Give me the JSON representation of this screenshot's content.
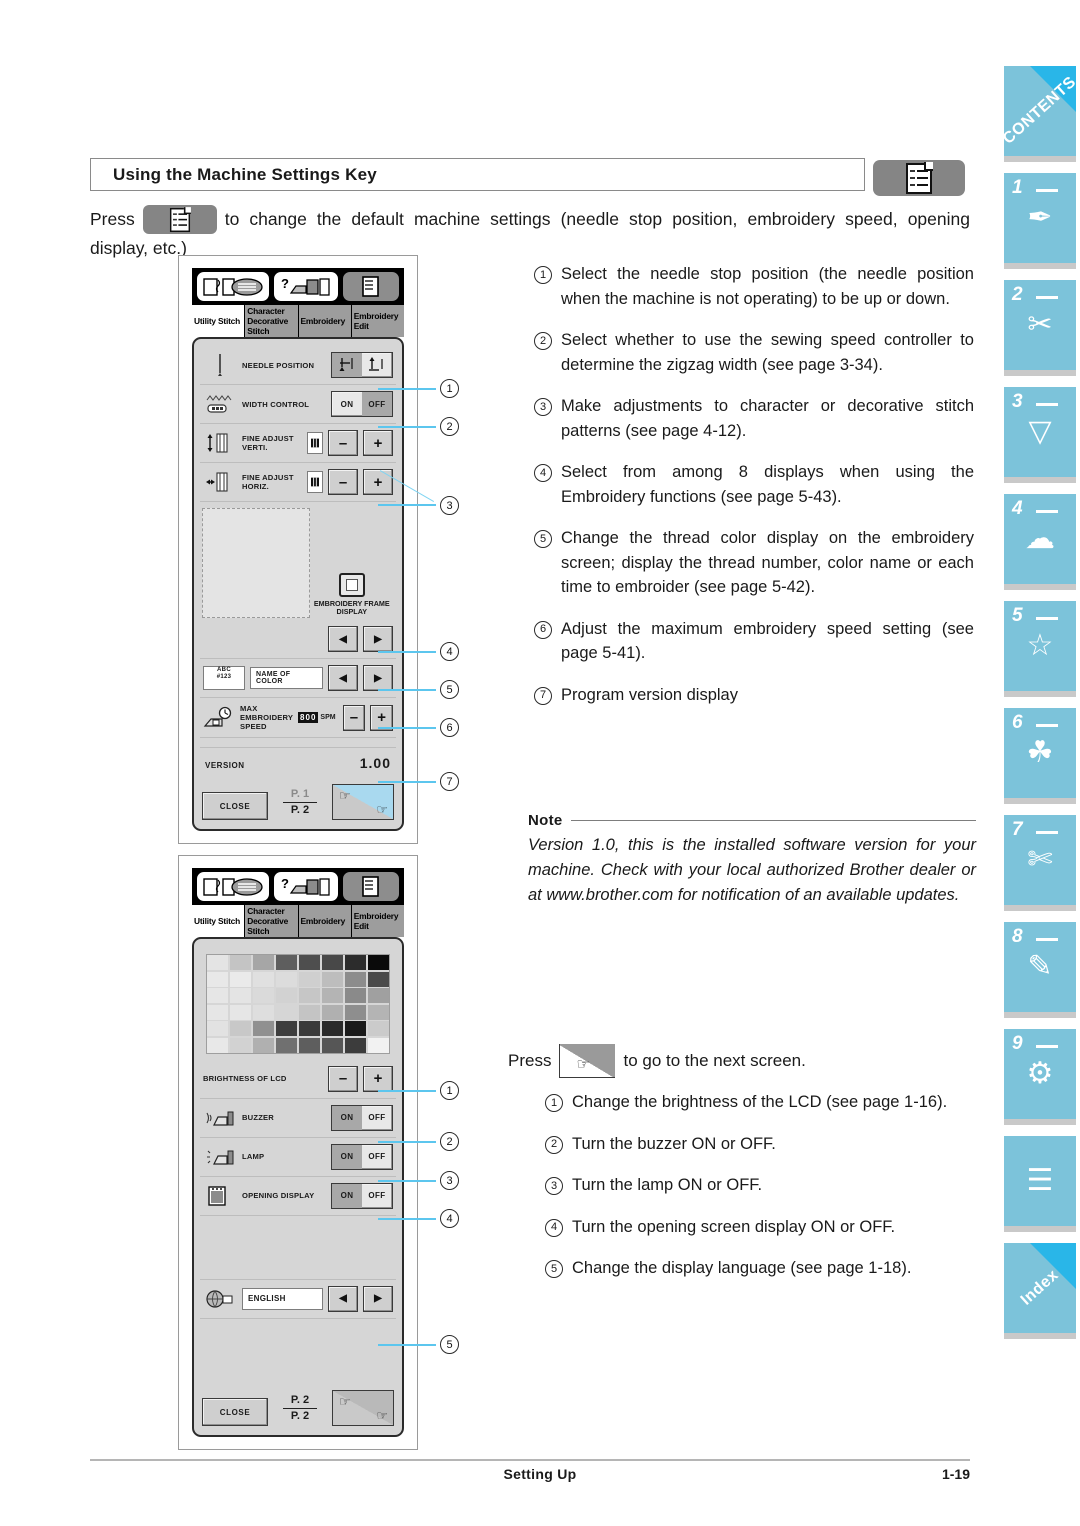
{
  "header": {
    "section_title": "Using the Machine Settings Key",
    "settings_key_icon": "checklist-document-icon"
  },
  "intro": {
    "press_label": "Press",
    "text_after_key": "to change the default machine settings (needle stop position, embroidery speed, opening display, etc.)"
  },
  "screen1": {
    "nav_icons": [
      "sewing-machine-stitch-icon",
      "help-machine-icon",
      "settings-checklist-icon"
    ],
    "tabs": [
      {
        "label": "Utility Stitch",
        "active": true
      },
      {
        "label": "Character Decorative Stitch",
        "active": false
      },
      {
        "label": "Embroidery",
        "active": false
      },
      {
        "label": "Embroidery Edit",
        "active": false
      }
    ],
    "rows": [
      {
        "label": "NEEDLE POSITION",
        "icon": "needle-icon",
        "control": "needle-updown-toggle",
        "options": [
          "down",
          "up"
        ],
        "selected": "down"
      },
      {
        "label": "WIDTH CONTROL",
        "icon": "zigzag-width-icon",
        "control": "on-off-toggle",
        "options": [
          "ON",
          "OFF"
        ],
        "selected": "OFF"
      },
      {
        "label": "FINE ADJUST VERTI.",
        "icon": "vertical-arrow-icon",
        "control": "minus-plus",
        "minus": "–",
        "plus": "+"
      },
      {
        "label": "FINE ADJUST HORIZ.",
        "icon": "horizontal-arrow-icon",
        "control": "minus-plus",
        "minus": "–",
        "plus": "+"
      }
    ],
    "frame_display": {
      "caption": "EMBROIDERY FRAME DISPLAY",
      "icon": "embroidery-hoop-icon",
      "left": "◀",
      "right": "▶"
    },
    "color_row": {
      "icon": "thread-abc-123-icon",
      "icon_text_1": "ABC",
      "icon_text_2": "#123",
      "value": "NAME OF COLOR",
      "left": "◀",
      "right": "▶"
    },
    "speed_row": {
      "icon": "max-speed-icon",
      "label": "MAX EMBROIDERY SPEED",
      "value": "800",
      "unit": "SPM",
      "minus": "–",
      "plus": "+"
    },
    "version": {
      "label": "VERSION",
      "value": "1.00"
    },
    "close_label": "CLOSE",
    "pager": {
      "current": "P. 1",
      "total": "P. 2"
    },
    "next_key_icon": "pointing-hand-next-icon"
  },
  "screen2": {
    "tabs": [
      {
        "label": "Utility Stitch",
        "active": true
      },
      {
        "label": "Character Decorative Stitch",
        "active": false
      },
      {
        "label": "Embroidery",
        "active": false
      },
      {
        "label": "Embroidery Edit",
        "active": false
      }
    ],
    "grayscale_grid": {
      "columns": 8,
      "rows": [
        [
          "#e4e4e4",
          "#c4c4c4",
          "#a6a6a6",
          "#5e5e5e",
          "#4e4e4e",
          "#484848",
          "#2c2c2c",
          "#0a0a0a"
        ],
        [
          "#e8e8e8",
          "#eaeaea",
          "#e0e0e0",
          "#dcdcdc",
          "#cfcfcf",
          "#bdbdbd",
          "#8c8c8c",
          "#4a4a4a"
        ],
        [
          "#e6e6e6",
          "#e4e4e4",
          "#dadada",
          "#d2d2d2",
          "#c6c6c6",
          "#b4b4b4",
          "#8a8a8a",
          "#a0a0a0"
        ],
        [
          "#e6e6e6",
          "#e6e6e6",
          "#dedede",
          "#d6d6d6",
          "#c4c4c4",
          "#b0b0b0",
          "#8e8e8e",
          "#b4b4b4"
        ],
        [
          "#e2e2e2",
          "#c8c8c8",
          "#909090",
          "#3d3d3d",
          "#3a3a3a",
          "#2a2a2a",
          "#1a1a1a",
          "#cbcbcb"
        ],
        [
          "#e8e8e8",
          "#d2d2d2",
          "#b0b0b0",
          "#707070",
          "#5e5e5e",
          "#565656",
          "#3c3c3c",
          "#f2f2f2"
        ]
      ]
    },
    "brightness_row": {
      "label": "BRIGHTNESS OF LCD",
      "minus": "–",
      "plus": "+"
    },
    "rows": [
      {
        "label": "BUZZER",
        "icon": "buzzer-machine-icon",
        "options": [
          "ON",
          "OFF"
        ],
        "selected": "ON"
      },
      {
        "label": "LAMP",
        "icon": "lamp-machine-icon",
        "options": [
          "ON",
          "OFF"
        ],
        "selected": "ON"
      },
      {
        "label": "OPENING DISPLAY",
        "icon": "opening-display-icon",
        "options": [
          "ON",
          "OFF"
        ],
        "selected": "ON"
      }
    ],
    "language_row": {
      "icon": "globe-language-icon",
      "value": "ENGLISH",
      "left": "◀",
      "right": "▶"
    },
    "close_label": "CLOSE",
    "pager": {
      "current": "P. 2",
      "total": "P. 2"
    },
    "next_key_icon": "pointing-hand-next-icon"
  },
  "callouts_screen1": [
    "1",
    "2",
    "3",
    "4",
    "5",
    "6",
    "7"
  ],
  "callouts_screen2": [
    "1",
    "2",
    "3",
    "4",
    "5"
  ],
  "right_items_top": [
    {
      "num": "①",
      "text": "Select the needle stop position (the needle position when the machine is not operating) to be up or down."
    },
    {
      "num": "②",
      "text": "Select whether to use the sewing speed controller to determine the zigzag width (see page 3-34)."
    },
    {
      "num": "③",
      "text": "Make adjustments to character or decorative stitch patterns (see page 4-12)."
    },
    {
      "num": "④",
      "text": "Select from among 8 displays when using the Embroidery functions (see page 5-43)."
    },
    {
      "num": "⑤",
      "text": "Change the thread color display on the embroidery screen; display the thread number, color name or each time to embroider (see page 5-42)."
    },
    {
      "num": "⑥",
      "text": "Adjust the maximum embroidery speed setting (see page 5-41)."
    },
    {
      "num": "⑦",
      "text": "Program version display"
    }
  ],
  "note": {
    "label": "Note",
    "body": "Version 1.0, this is the installed software version for your machine. Check with your local authorized Brother dealer or at www.brother.com for notification of an available updates."
  },
  "press_next": {
    "press_label": "Press",
    "after_label": "to go to the next screen.",
    "key_icon": "pointing-hand-next-icon"
  },
  "right_items_bottom": [
    {
      "num": "①",
      "text": "Change the brightness of the LCD (see page 1-16)."
    },
    {
      "num": "②",
      "text": "Turn the buzzer ON or OFF."
    },
    {
      "num": "③",
      "text": "Turn the lamp ON or OFF."
    },
    {
      "num": "④",
      "text": "Turn the opening screen display ON or OFF."
    },
    {
      "num": "⑤",
      "text": "Change the display language (see page 1-18)."
    }
  ],
  "sidebar": {
    "accent_color": "#7cc3da",
    "corner_color": "#29b6e8",
    "items": [
      {
        "kind": "diag",
        "label": "CONTENTS",
        "name": "sidebar-tab-contents"
      },
      {
        "kind": "num",
        "num": "1",
        "glyph": "✒",
        "name": "sidebar-tab-1"
      },
      {
        "kind": "num",
        "num": "2",
        "glyph": "✂",
        "name": "sidebar-tab-2"
      },
      {
        "kind": "num",
        "num": "3",
        "glyph": "▽",
        "name": "sidebar-tab-3"
      },
      {
        "kind": "num",
        "num": "4",
        "glyph": "☁",
        "name": "sidebar-tab-4"
      },
      {
        "kind": "num",
        "num": "5",
        "glyph": "☆",
        "name": "sidebar-tab-5"
      },
      {
        "kind": "num",
        "num": "6",
        "glyph": "☘",
        "name": "sidebar-tab-6"
      },
      {
        "kind": "num",
        "num": "7",
        "glyph": "✄",
        "name": "sidebar-tab-7"
      },
      {
        "kind": "num",
        "num": "8",
        "glyph": "✎",
        "name": "sidebar-tab-8"
      },
      {
        "kind": "num",
        "num": "9",
        "glyph": "⚙",
        "name": "sidebar-tab-9"
      },
      {
        "kind": "plain",
        "glyph": "☰",
        "name": "sidebar-tab-appendix"
      },
      {
        "kind": "diag",
        "label": "Index",
        "name": "sidebar-tab-index"
      }
    ]
  },
  "footer": {
    "center": "Setting Up",
    "page": "1-19"
  }
}
